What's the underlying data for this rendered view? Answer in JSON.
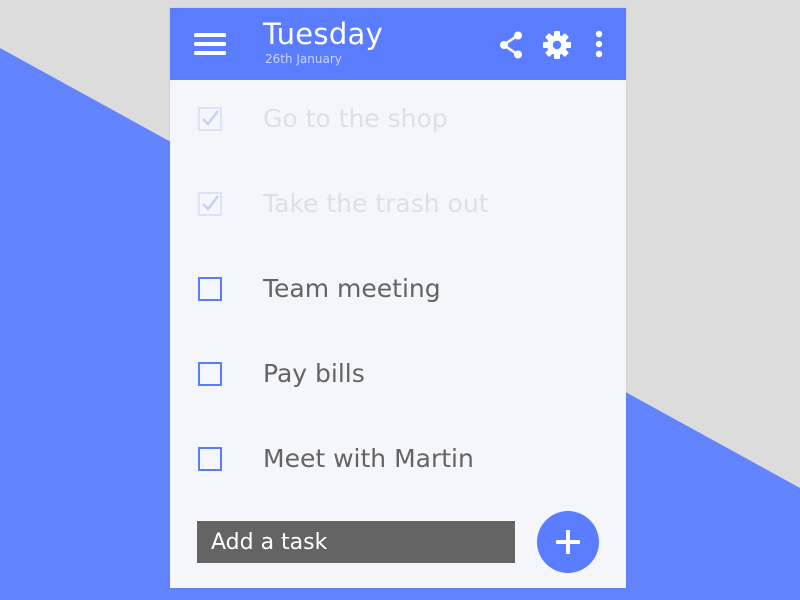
{
  "colors": {
    "accent": "#5a7cff",
    "background": "#dcdcdc",
    "panel": "#f4f6fb",
    "done_text": "#dcdfe7",
    "todo_text": "#646464",
    "input_bg": "#646464"
  },
  "header": {
    "title": "Tuesday",
    "date": "26th January",
    "menu_icon": "hamburger-menu-icon",
    "actions": [
      "share-icon",
      "gear-icon",
      "more-vertical-icon"
    ]
  },
  "tasks": [
    {
      "label": "Go to the shop",
      "done": true
    },
    {
      "label": "Take the trash out",
      "done": true
    },
    {
      "label": "Team meeting",
      "done": false
    },
    {
      "label": "Pay bills",
      "done": false
    },
    {
      "label": "Meet with Martin",
      "done": false
    }
  ],
  "add_task": {
    "placeholder": "Add a task",
    "button_icon": "plus-icon"
  }
}
